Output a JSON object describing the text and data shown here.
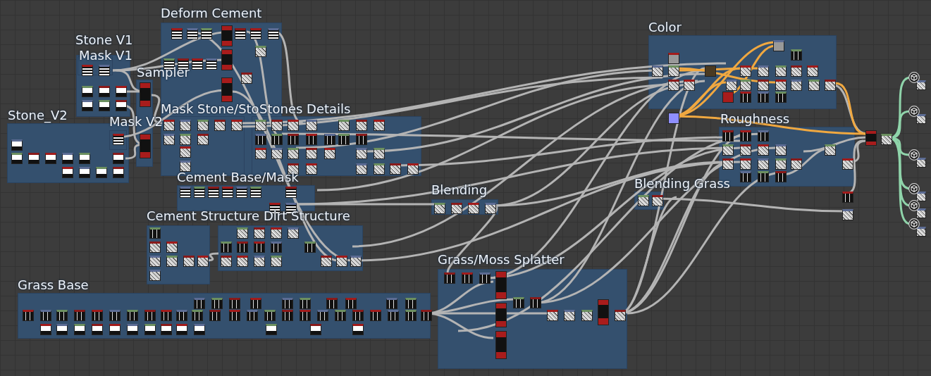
{
  "frames": [
    {
      "title": "Deform Cement"
    },
    {
      "title": "Stone V1"
    },
    {
      "title": "Mask V1"
    },
    {
      "title": "Sampler"
    },
    {
      "title": "Stone_V2"
    },
    {
      "title": "Mask V2"
    },
    {
      "title": "Mask Stone/Sto"
    },
    {
      "title": "Stones Details"
    },
    {
      "title": "Cement Base/Mask"
    },
    {
      "title": "Cement Structure"
    },
    {
      "title": "Dirt Structure"
    },
    {
      "title": "Blending"
    },
    {
      "title": "Blending Grass"
    },
    {
      "title": "Color"
    },
    {
      "title": "Roughness"
    },
    {
      "title": "Grass/Moss Splatter"
    },
    {
      "title": "Grass Base"
    }
  ]
}
